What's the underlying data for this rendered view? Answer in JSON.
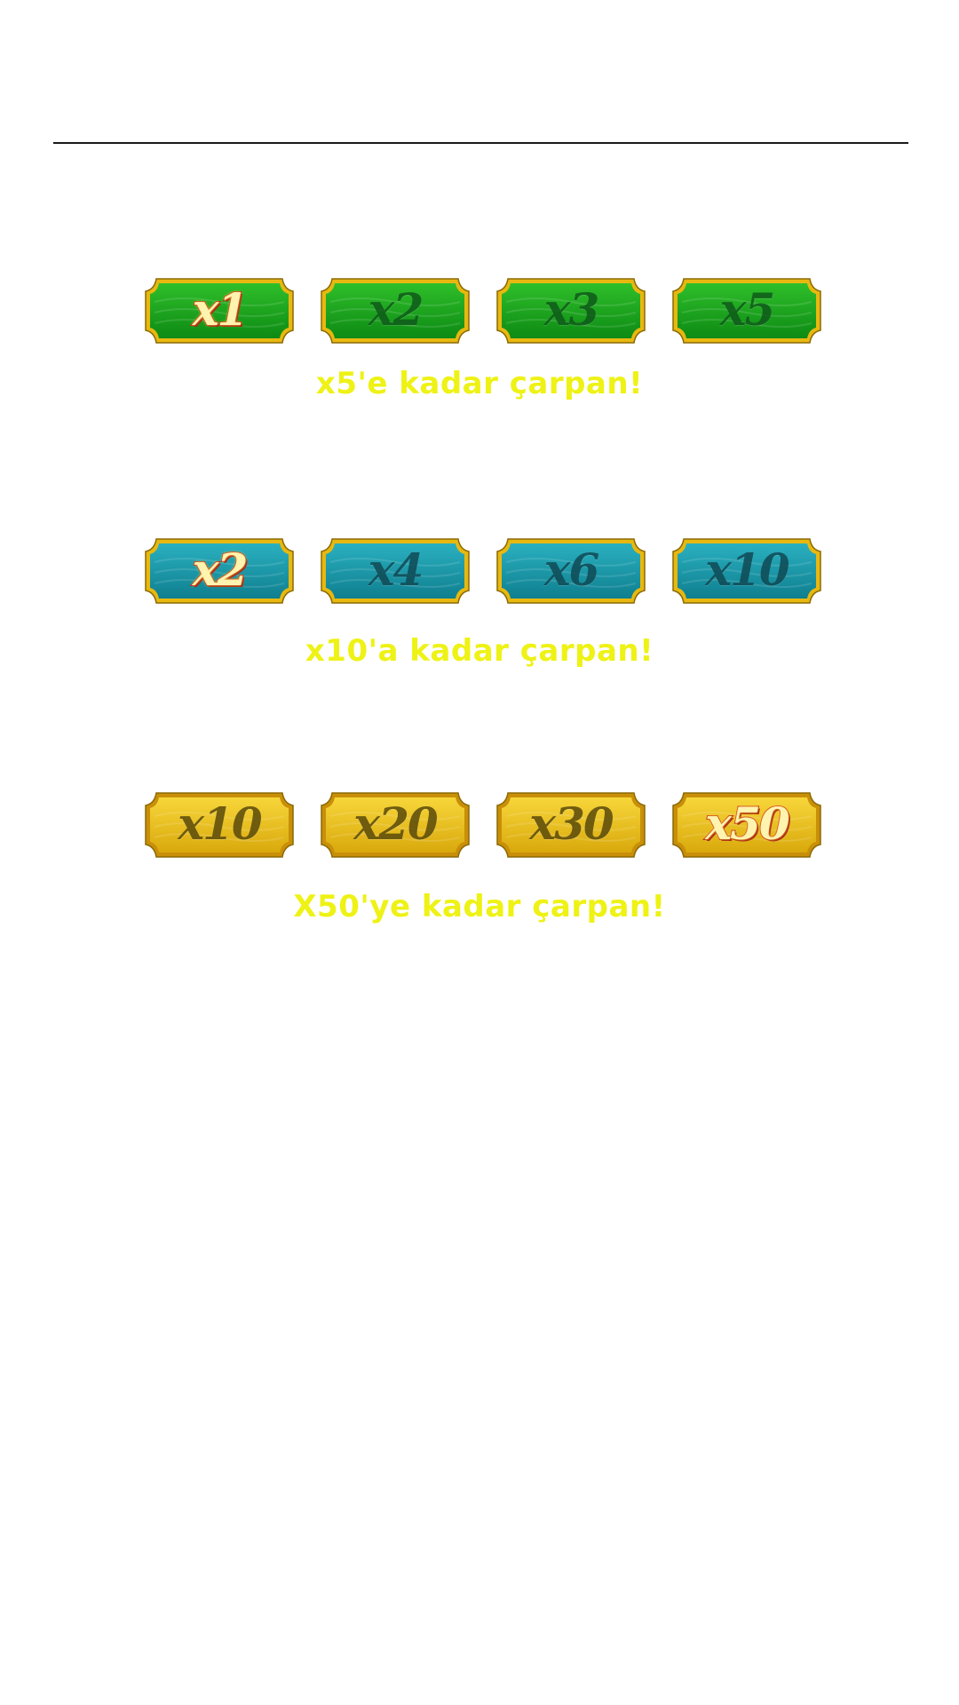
{
  "groups": [
    {
      "theme": "green",
      "colors": {
        "top": "#2fbf2a",
        "bottom": "#0d8a14",
        "frame": "#e8b810"
      },
      "tiles": [
        {
          "label": "x1",
          "active": true
        },
        {
          "label": "x2",
          "active": false
        },
        {
          "label": "x3",
          "active": false
        },
        {
          "label": "x5",
          "active": false
        }
      ],
      "caption": "x5'e kadar çarpan!"
    },
    {
      "theme": "teal",
      "colors": {
        "top": "#2ab0c0",
        "bottom": "#0f7f8f",
        "frame": "#e8b810"
      },
      "tiles": [
        {
          "label": "x2",
          "active": true
        },
        {
          "label": "x4",
          "active": false
        },
        {
          "label": "x6",
          "active": false
        },
        {
          "label": "x10",
          "active": false
        }
      ],
      "caption": "x10'a kadar çarpan!"
    },
    {
      "theme": "gold",
      "colors": {
        "top": "#f7d63a",
        "bottom": "#d9a90c",
        "frame": "#c98f08"
      },
      "tiles": [
        {
          "label": "x10",
          "active": false
        },
        {
          "label": "x20",
          "active": false
        },
        {
          "label": "x30",
          "active": false
        },
        {
          "label": "x50",
          "active": true
        }
      ],
      "caption": "X50'ye kadar çarpan!"
    }
  ]
}
